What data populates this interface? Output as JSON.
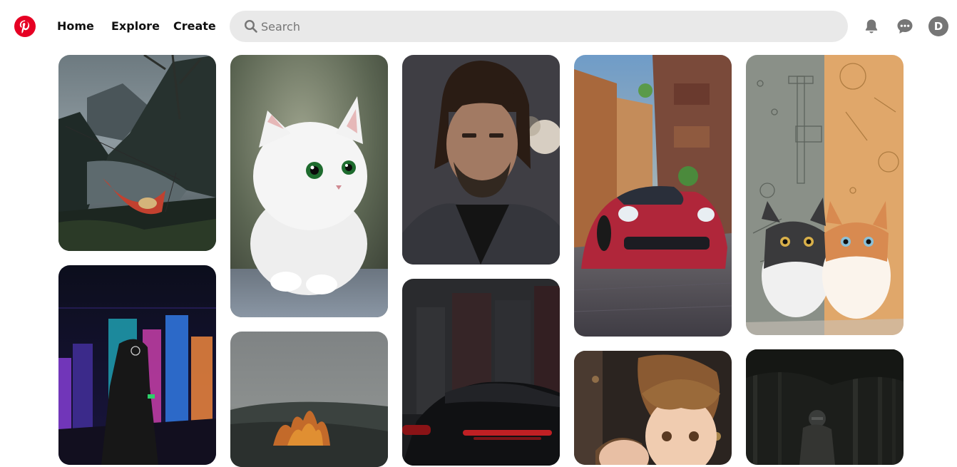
{
  "header": {
    "nav": {
      "home": "Home",
      "explore": "Explore",
      "create": "Create"
    },
    "search": {
      "placeholder": "Search"
    },
    "avatar_initial": "D",
    "icons": {
      "logo": "pinterest-logo",
      "search": "search-icon",
      "notifications": "bell-icon",
      "messages": "chat-bubble-icon"
    }
  },
  "pins": [
    {
      "name": "pin-fjord-hammock",
      "subject": "person in red hammock over misty fjord"
    },
    {
      "name": "pin-neon-city-figure",
      "subject": "hooded figure in neon cyberpunk city"
    },
    {
      "name": "pin-white-kitten",
      "subject": "fluffy white kitten with green eyes"
    },
    {
      "name": "pin-campfire",
      "subject": "campfire flames in foggy forest"
    },
    {
      "name": "pin-man-portrait",
      "subject": "long-haired bearded man portrait"
    },
    {
      "name": "pin-black-sports-car",
      "subject": "black sports car in dark city"
    },
    {
      "name": "pin-red-car-street",
      "subject": "red sports car on anime street"
    },
    {
      "name": "pin-anime-children",
      "subject": "animated boy and girl"
    },
    {
      "name": "pin-two-cats-illustration",
      "subject": "two cartoon kittens"
    },
    {
      "name": "pin-forest-rider",
      "subject": "rider in dark forest"
    }
  ],
  "colors": {
    "brand": "#e60023",
    "search_bg": "#e9e9e9",
    "icon": "#767676",
    "text": "#111111"
  }
}
